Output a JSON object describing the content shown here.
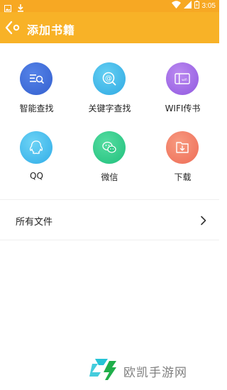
{
  "status_bar": {
    "time": "3:05",
    "left_icons": [
      "image-icon",
      "download-icon"
    ],
    "right_icons": [
      "wifi-icon",
      "signal-icon",
      "battery-icon"
    ]
  },
  "app_bar": {
    "back_icon": "back-arrow-icon",
    "title": "添加书籍",
    "color": "#f8b227"
  },
  "sources": [
    {
      "label": "智能查找",
      "icon": "smart-search-icon",
      "color": "#3f6fd9"
    },
    {
      "label": "关键字查找",
      "icon": "keyword-search-icon",
      "color": "#41b9ea"
    },
    {
      "label": "WIFI传书",
      "icon": "wifi-transfer-icon",
      "color": "#a36be8"
    },
    {
      "label": "QQ",
      "icon": "qq-icon",
      "color": "#40bdf0"
    },
    {
      "label": "微信",
      "icon": "wechat-icon",
      "color": "#2fcf8c"
    },
    {
      "label": "下载",
      "icon": "download-folder-icon",
      "color": "#f27a62"
    }
  ],
  "all_files": {
    "label": "所有文件",
    "chevron_icon": "chevron-right-icon"
  },
  "watermark": {
    "text": "欧凯手游网",
    "logo_icon": "site-logo-icon"
  }
}
